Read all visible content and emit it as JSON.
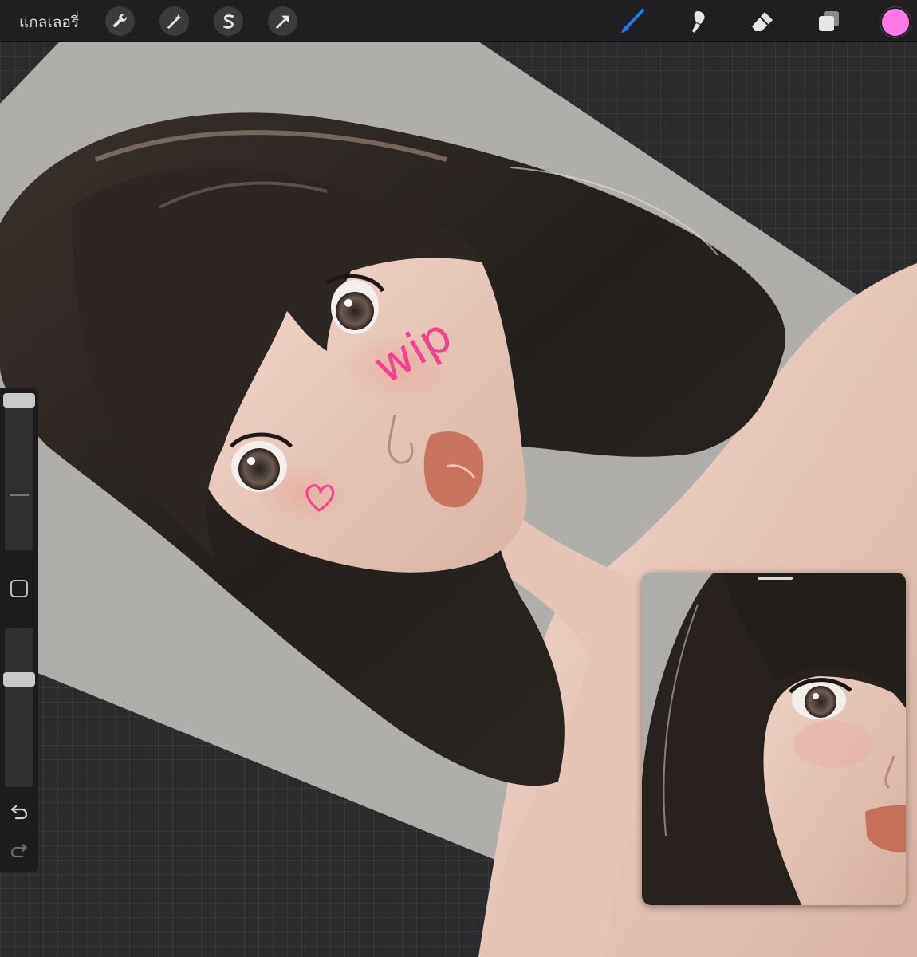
{
  "toolbar": {
    "gallery_label": "แกลเลอรี่",
    "active_color": "#ff7ae6",
    "accent_color": "#1e7bf0",
    "left_tools": [
      "wrench-icon",
      "magic-wand-icon",
      "selection-s-icon",
      "move-arrow-icon"
    ],
    "right_tools": [
      "brush-icon",
      "smudge-icon",
      "eraser-icon",
      "layers-icon"
    ]
  },
  "canvas": {
    "annotation_text": "wip",
    "annotation_color": "#f2428f"
  },
  "sidebar": {
    "tools": [
      "brush-size-slider",
      "modify-square-icon",
      "opacity-slider",
      "undo-icon",
      "redo-icon"
    ]
  },
  "reference": {
    "title": ""
  }
}
